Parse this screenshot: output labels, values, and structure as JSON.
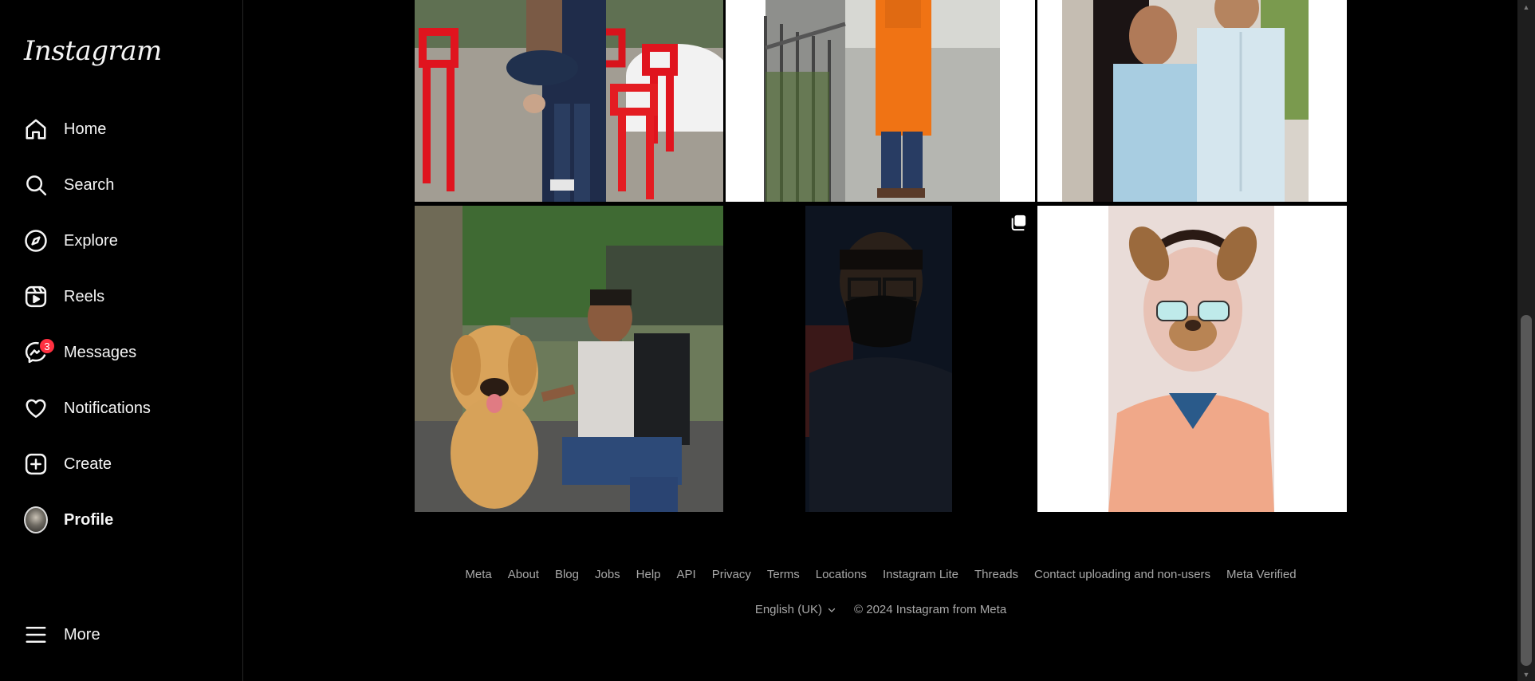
{
  "brand": {
    "logo_text": "Instagram"
  },
  "nav": {
    "home": "Home",
    "search": "Search",
    "explore": "Explore",
    "reels": "Reels",
    "messages": "Messages",
    "messages_badge": "3",
    "notifications": "Notifications",
    "create": "Create",
    "profile": "Profile",
    "more": "More"
  },
  "footer": {
    "links": [
      "Meta",
      "About",
      "Blog",
      "Jobs",
      "Help",
      "API",
      "Privacy",
      "Terms",
      "Locations",
      "Instagram Lite",
      "Threads",
      "Contact uploading and non-users",
      "Meta Verified"
    ],
    "language": "English (UK)",
    "copyright": "© 2024 Instagram from Meta"
  },
  "colors": {
    "background": "#000000",
    "text": "#f5f5f5",
    "muted": "#a8a8a8",
    "badge": "#ff3040",
    "divider": "#262626"
  },
  "icons": [
    "home-icon",
    "search-icon",
    "explore-icon",
    "reels-icon",
    "messenger-icon",
    "heart-icon",
    "create-icon",
    "hamburger-icon",
    "multiple-photos-icon",
    "chevron-down-icon"
  ]
}
